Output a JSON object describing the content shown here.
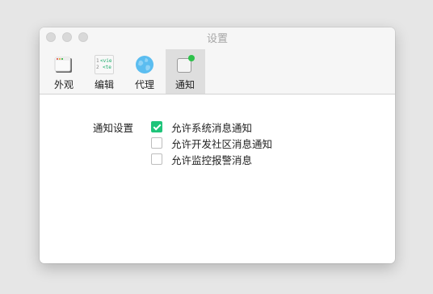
{
  "window": {
    "title": "设置"
  },
  "toolbar": {
    "tabs": [
      {
        "label": "外观",
        "icon": "appearance-window-icon",
        "active": false
      },
      {
        "label": "编辑",
        "icon": "code-editor-icon",
        "active": false
      },
      {
        "label": "代理",
        "icon": "globe-icon",
        "active": false
      },
      {
        "label": "通知",
        "icon": "notification-badge-icon",
        "active": true
      }
    ]
  },
  "notifications": {
    "section_label": "通知设置",
    "options": [
      {
        "label": "允许系统消息通知",
        "checked": true
      },
      {
        "label": "允许开发社区消息通知",
        "checked": false
      },
      {
        "label": "允许监控报警消息",
        "checked": false
      }
    ]
  },
  "colors": {
    "accent_green": "#1fc47a",
    "globe_blue": "#5bbdf0",
    "active_tab_bg": "#dedede"
  }
}
